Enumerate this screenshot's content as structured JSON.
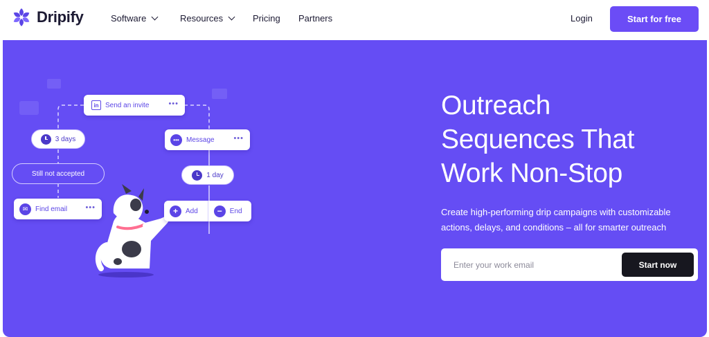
{
  "brand": {
    "name": "Dripify"
  },
  "nav": {
    "items": [
      {
        "label": "Software",
        "has_dropdown": true
      },
      {
        "label": "Resources",
        "has_dropdown": true
      },
      {
        "label": "Pricing",
        "has_dropdown": false
      },
      {
        "label": "Partners",
        "has_dropdown": false
      }
    ],
    "login": "Login",
    "cta": "Start for free"
  },
  "illustration": {
    "send_invite": "Send an invite",
    "delay_left": "3 days",
    "condition": "Still not accepted",
    "find_email": "Find email",
    "message": "Message",
    "delay_right": "1 day",
    "add": "Add",
    "end": "End",
    "more": "•••"
  },
  "hero": {
    "headline": [
      "Outreach",
      "Sequences That",
      "Work Non-Stop"
    ],
    "subtitle": "Create high-performing drip campaigns with customizable actions, delays, and conditions – all for smarter outreach",
    "email_placeholder": "Enter your work email",
    "email_value": "",
    "cta": "Start now"
  },
  "colors": {
    "brand": "#6b4cf6",
    "hero_bg": "#654df4",
    "dark_button": "#17171f"
  },
  "icons": [
    "dripify-logo-icon",
    "chevron-down-icon",
    "linkedin-icon",
    "clock-icon",
    "message-icon",
    "mail-icon",
    "plus-icon",
    "minus-icon",
    "dog-mascot"
  ]
}
